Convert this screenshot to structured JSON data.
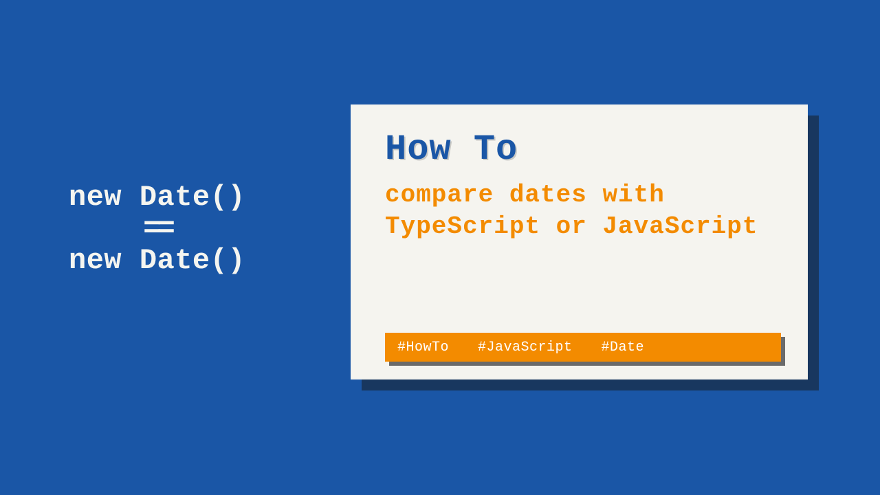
{
  "code": {
    "line1": "new Date()",
    "eq": "==",
    "line2": "new Date()"
  },
  "card": {
    "title": "How To",
    "subtitle": "compare dates with TypeScript or JavaScript"
  },
  "tags": {
    "items": [
      "#HowTo",
      "#JavaScript",
      "#Date"
    ]
  },
  "colors": {
    "background": "#1a56a6",
    "card": "#f5f4ef",
    "accent": "#f38b00",
    "shadow": "#18375f"
  }
}
